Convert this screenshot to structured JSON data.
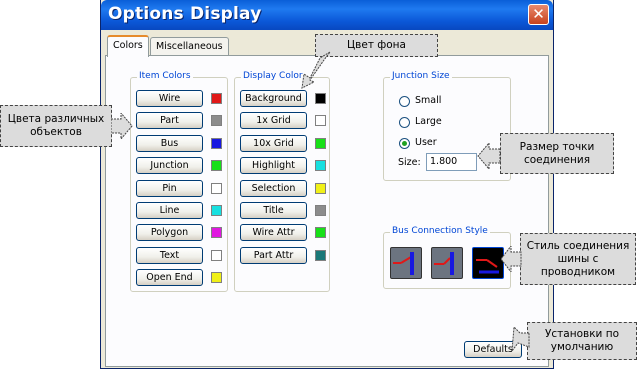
{
  "window": {
    "title": "Options Display",
    "close_symbol": "✕"
  },
  "tabs": [
    {
      "label": "Colors",
      "active": true
    },
    {
      "label": "Miscellaneous",
      "active": false
    }
  ],
  "item_colors": {
    "title": "Item Colors",
    "items": [
      {
        "label": "Wire",
        "color": "#e01818"
      },
      {
        "label": "Part",
        "color": "#8c8c8c"
      },
      {
        "label": "Bus",
        "color": "#1818e0"
      },
      {
        "label": "Junction",
        "color": "#18e018"
      },
      {
        "label": "Pin",
        "color": "#ffffff"
      },
      {
        "label": "Line",
        "color": "#18e0e0"
      },
      {
        "label": "Polygon",
        "color": "#e018e0"
      },
      {
        "label": "Text",
        "color": "#ffffff"
      },
      {
        "label": "Open End",
        "color": "#f0f018"
      }
    ]
  },
  "display_colors": {
    "title": "Display Color",
    "items": [
      {
        "label": "Background",
        "color": "#000000"
      },
      {
        "label": "1x Grid",
        "color": "#ffffff"
      },
      {
        "label": "10x Grid",
        "color": "#18e018"
      },
      {
        "label": "Highlight",
        "color": "#18e0e0"
      },
      {
        "label": "Selection",
        "color": "#f0f018"
      },
      {
        "label": "Title",
        "color": "#8c8c8c"
      },
      {
        "label": "Wire Attr",
        "color": "#18e018"
      },
      {
        "label": "Part Attr",
        "color": "#1a7878"
      }
    ]
  },
  "junction_size": {
    "title": "Junction Size",
    "options": [
      {
        "label": "Small",
        "checked": false
      },
      {
        "label": "Large",
        "checked": false
      },
      {
        "label": "User",
        "checked": true
      }
    ],
    "size_label": "Size:",
    "size_value": "1.800"
  },
  "bus_connection": {
    "title": "Bus Connection Style",
    "styles": [
      "bus-style-angled-icon",
      "bus-style-diagonal-icon",
      "bus-style-angled-dark-icon"
    ]
  },
  "defaults_button": {
    "label": "Defaults"
  },
  "callouts": {
    "background_color": "Цвет фона",
    "object_colors": "Цвета различных объектов",
    "junction_size": "Размер точки соединения",
    "bus_style": "Стиль соединения шины с проводником",
    "defaults": "Установки по умолчанию"
  }
}
